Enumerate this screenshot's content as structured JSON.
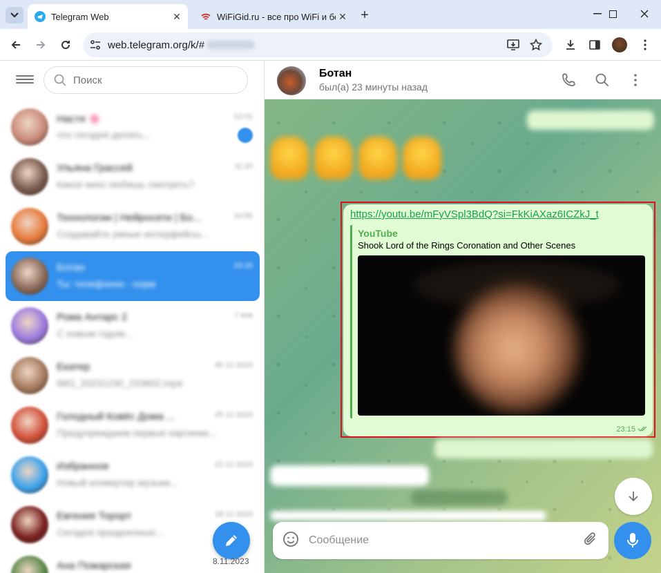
{
  "browser": {
    "tabs": [
      {
        "title": "Telegram Web",
        "favicon": "telegram-icon",
        "active": true
      },
      {
        "title": "WiFiGid.ru - все про WiFi и бес",
        "favicon": "wifi-icon",
        "active": false
      }
    ],
    "url": "web.telegram.org/k/#"
  },
  "sidebar": {
    "search_placeholder": "Поиск",
    "compose_date": "8.11.2023",
    "chats": [
      {
        "name": "Настя 🌸",
        "preview": "что сегодня делать...",
        "time": "12:01",
        "selected": false,
        "unread": true,
        "color": "#c98a7a"
      },
      {
        "name": "Ульяна Грассей",
        "preview": "Какое кино любишь смотреть?",
        "time": "11:20",
        "selected": false,
        "unread": false,
        "color": "#7a5a4e"
      },
      {
        "name": "Технологии | Нейросети | Бо...",
        "preview": "Создавайте умные интерфейсы...",
        "time": "10:55",
        "selected": false,
        "unread": false,
        "color": "#e67a3c"
      },
      {
        "name": "Ботан",
        "preview": "Ты: телефонно - норм",
        "time": "23:15",
        "selected": true,
        "unread": false,
        "color": "#8a6a5a"
      },
      {
        "name": "Рома Антарс 2",
        "preview": "С новым годом...",
        "time": "7 янв",
        "selected": false,
        "unread": false,
        "color": "#9b7be0"
      },
      {
        "name": "Екатер",
        "preview": "IMG_20231230_233602.mp4",
        "time": "30.12.2023",
        "selected": false,
        "unread": false,
        "color": "#a57a5e"
      },
      {
        "name": "Голодный Ковёс Дома ...",
        "preview": "Предупреждаем первые картинки...",
        "time": "25.12.2023",
        "selected": false,
        "unread": false,
        "color": "#d2503a"
      },
      {
        "name": "Избранное",
        "preview": "Новый конвертер музыки...",
        "time": "22.12.2023",
        "selected": false,
        "unread": false,
        "color": "#3ca3ec"
      },
      {
        "name": "Евгения Торорт",
        "preview": "Сегодня праздничные...",
        "time": "18.12.2023",
        "selected": false,
        "unread": false,
        "color": "#7a2020"
      },
      {
        "name": "Ана Пожарская",
        "preview": "",
        "time": "",
        "selected": false,
        "unread": false,
        "color": "#5a8a4a"
      }
    ]
  },
  "chat": {
    "name": "Ботан",
    "status": "был(а) 23 минуты назад",
    "message": {
      "link": "https://youtu.be/mFyVSpl3BdQ?si=FkKiAXaz6ICZkJ_t",
      "site": "YouTube",
      "title": "Shook Lord of the Rings Coronation and Other Scenes",
      "time": "23:15"
    },
    "composer_placeholder": "Сообщение"
  },
  "colors": {
    "accent": "#3390ec",
    "highlight": "#e0101a",
    "bubble": "#e1fbd4",
    "link": "#16a34a"
  }
}
